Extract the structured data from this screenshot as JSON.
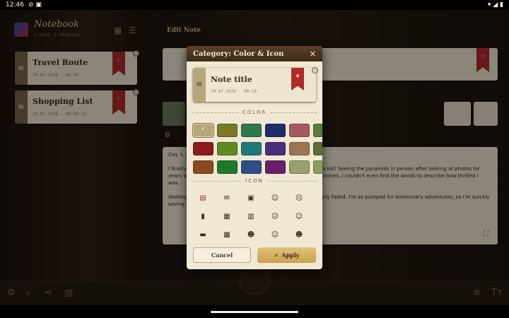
{
  "status": {
    "time": "12:46"
  },
  "app": {
    "title": "Notebook",
    "subtitle": "2 notes · 1 categories"
  },
  "notes": [
    {
      "title": "Travel Route",
      "date": "29.07.2026 · 00:39"
    },
    {
      "title": "Shopping List",
      "date": "29.07.2026 · 00:38:32"
    }
  ],
  "editor": {
    "header": "Edit Note",
    "body_heading": "Day 1: C",
    "body_p1a": "I finally",
    "body_p1b": "years w",
    "body_p1c": "was.",
    "body_p1d": "a kid! Seeing the pyramids in person after looking at photos for",
    "body_p1e": "stones, I couldn't even find the words to describe how thrilled I",
    "body_p2a": "Walking",
    "body_p2b": "saving a",
    "body_p2c": "ely faded. I'm so pumped for tomorrow's adventures, so I'm quickly"
  },
  "dialog": {
    "title": "Category: Color & Icon",
    "preview_title": "Note title",
    "preview_date": "29.07.2026 · 00:19",
    "color_label": "COLOR",
    "icon_label": "ICON",
    "cancel": "Cancel",
    "apply": "Apply",
    "colors": [
      "#b6a679",
      "#7a7a27",
      "#2c7a4c",
      "#1e2d6c",
      "#a35b5f",
      "#5a7e35",
      "#8a1a1f",
      "#5f8a22",
      "#1e7a7a",
      "#4a2e7a",
      "#9b7650",
      "#5e6d34",
      "#8a4a1c",
      "#1d7a28",
      "#2e4e8a",
      "#6a1f6a",
      "#97a26a",
      "#88a058"
    ],
    "icons": [
      "note-icon",
      "mail-icon",
      "calendar-x-icon",
      "smile-icon",
      "frown-icon",
      "file-icon",
      "event-icon",
      "map-icon",
      "sad-icon",
      "smile-2-icon",
      "folder-icon",
      "calendar-check-icon",
      "face-icon",
      "happy-icon",
      "grin-icon"
    ]
  },
  "colors": {
    "accent": "#b02a2a",
    "header": "#4b331f",
    "apply": "#d8b564"
  }
}
